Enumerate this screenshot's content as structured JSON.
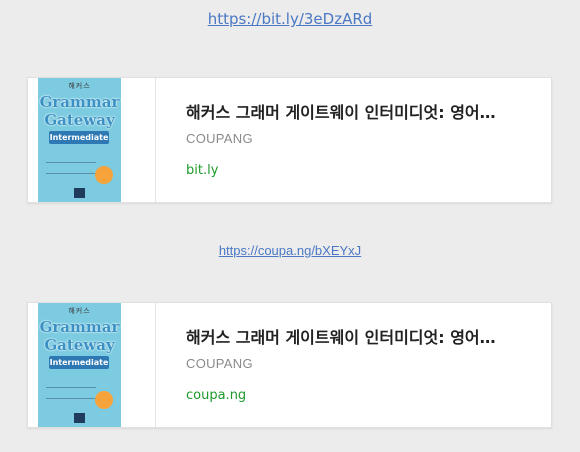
{
  "top_link": {
    "text": "https://bit.ly/3eDzARd"
  },
  "mid_link": {
    "text": "https://coupa.ng/bXEYxJ"
  },
  "cards": [
    {
      "title": "해커스 그래머 게이트웨이 인터미디엇: 영어…",
      "source": "COUPANG",
      "domain": "bit.ly",
      "thumbnail": {
        "series": "해커스",
        "title_line1": "Grammar",
        "title_line2": "Gateway",
        "subtitle": "Intermediate"
      }
    },
    {
      "title": "해커스 그래머 게이트웨이 인터미디엇: 영어…",
      "source": "COUPANG",
      "domain": "coupa.ng",
      "thumbnail": {
        "series": "해커스",
        "title_line1": "Grammar",
        "title_line2": "Gateway",
        "subtitle": "Intermediate"
      }
    }
  ],
  "colors": {
    "link": "#4a78c4",
    "domain": "#1d9a2c",
    "book_cover": "#7ccbe0"
  }
}
